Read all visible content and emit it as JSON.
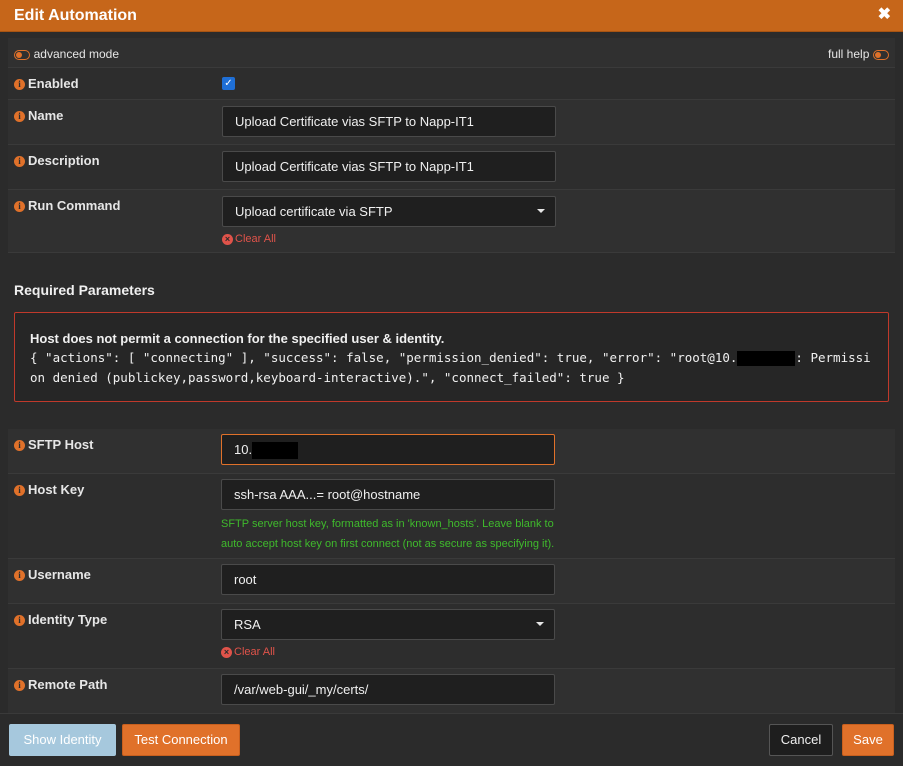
{
  "dialog": {
    "title": "Edit Automation",
    "close_glyph": "✖"
  },
  "toolbar": {
    "advanced_mode_label": "advanced mode",
    "full_help_label": "full help"
  },
  "fields": {
    "enabled": {
      "label": "Enabled",
      "checked": true
    },
    "name": {
      "label": "Name",
      "value": "Upload Certificate vias SFTP to Napp-IT1"
    },
    "description": {
      "label": "Description",
      "value": "Upload Certificate vias SFTP to Napp-IT1"
    },
    "run_command": {
      "label": "Run Command",
      "value": "Upload certificate via SFTP",
      "clear_label": "Clear All"
    }
  },
  "required_parameters": {
    "heading": "Required Parameters",
    "error": {
      "title": "Host does not permit a connection for the specified user & identity.",
      "detail_prefix": "{ \"actions\": [ \"connecting\" ], \"success\": false, \"permission_denied\": true, \"error\": \"root@10.",
      "detail_suffix": ": Permission denied (publickey,password,keyboard-interactive).\", \"connect_failed\": true }"
    },
    "sftp_host": {
      "label": "SFTP Host",
      "value": "10."
    },
    "host_key": {
      "label": "Host Key",
      "value": "ssh-rsa AAA...= root@hostname",
      "help": "SFTP server host key, formatted as in 'known_hosts'. Leave blank to auto accept host key on first connect (not as secure as specifying it)."
    },
    "username": {
      "label": "Username",
      "value": "root"
    },
    "identity_type": {
      "label": "Identity Type",
      "value": "RSA",
      "clear_label": "Clear All"
    },
    "remote_path": {
      "label": "Remote Path",
      "value": "/var/web-gui/_my/certs/"
    }
  },
  "buttons": {
    "show_identity": "Show Identity",
    "test_connection": "Test Connection",
    "cancel": "Cancel",
    "save": "Save"
  },
  "colors": {
    "accent": "#e0712a",
    "title_bar": "#c6661a",
    "error_border": "#c0392b",
    "help_text": "#3fba2c",
    "clear_text": "#e0534a"
  },
  "icons": {
    "info": "info-circle-icon",
    "clear": "times-circle-icon",
    "toggle": "toggle-icon",
    "select_caret": "caret-down-icon"
  }
}
